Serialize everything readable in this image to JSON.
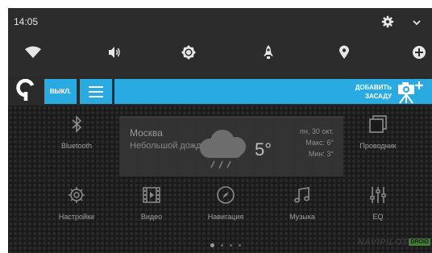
{
  "status_bar": {
    "time": "14:05",
    "icons": [
      "gear-icon",
      "chevron-down-icon"
    ]
  },
  "quick_settings": {
    "icons": [
      "wifi-icon",
      "volume-icon",
      "brightness-icon",
      "rocket-icon",
      "location-icon",
      "data-saver-icon"
    ]
  },
  "top_bar": {
    "off_button": "ВЫКЛ.",
    "add_rear_line1": "ДОБАВИТЬ",
    "add_rear_line2": "ЗАСАДУ",
    "accent_color": "#29abe2"
  },
  "weather": {
    "city": "Москва",
    "description": "Небольшой дождь",
    "temperature": "5°",
    "date": "пн, 30 окт.",
    "max": "Макс:  6°",
    "min": "Мин:  3°"
  },
  "apps": [
    {
      "label": "Bluetooth",
      "icon": "bluetooth-icon"
    },
    {
      "label": "Проводник",
      "icon": "file-manager-icon"
    },
    {
      "label": "Настройки",
      "icon": "settings-icon"
    },
    {
      "label": "Видео",
      "icon": "video-icon"
    },
    {
      "label": "Навигация",
      "icon": "navigation-icon"
    },
    {
      "label": "Музыка",
      "icon": "music-icon"
    },
    {
      "label": "EQ",
      "icon": "equalizer-icon"
    }
  ],
  "pager": {
    "pages": 4,
    "current": 1
  },
  "brand": {
    "name": "NAVIPILOT",
    "badge": "DROID"
  }
}
